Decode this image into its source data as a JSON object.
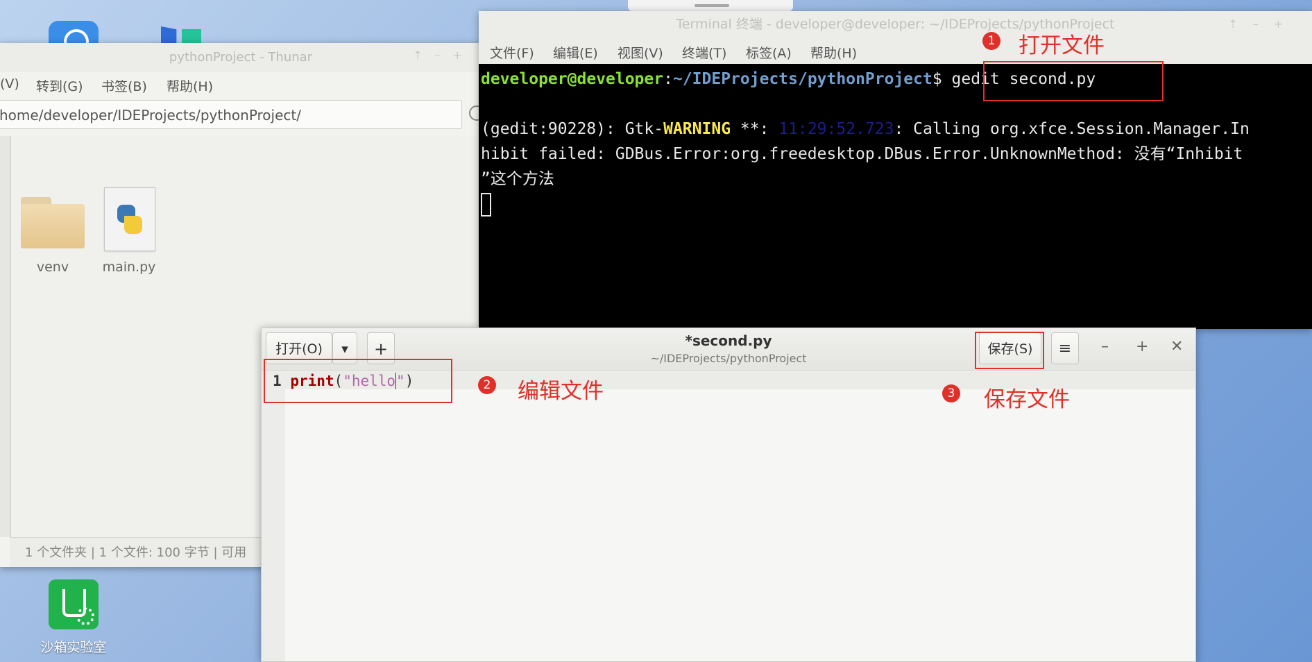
{
  "desktop": {
    "sandbox_label": "沙箱实验室"
  },
  "thunar": {
    "title": "pythonProject - Thunar",
    "menu": [
      "(V)",
      "转到(G)",
      "书签(B)",
      "帮助(H)"
    ],
    "path": "home/developer/IDEProjects/pythonProject/",
    "files": [
      {
        "name": "venv",
        "icon": "folder-icon"
      },
      {
        "name": "main.py",
        "icon": "python-file-icon"
      }
    ],
    "status": "1 个文件夹 | 1 个文件: 100 字节 | 可用"
  },
  "terminal": {
    "title": "Terminal 终端 - developer@developer: ~/IDEProjects/pythonProject",
    "menu": [
      "文件(F)",
      "编辑(E)",
      "视图(V)",
      "终端(T)",
      "标签(A)",
      "帮助(H)"
    ],
    "prompt_user": "developer@developer",
    "prompt_path": "~/IDEProjects/pythonProject",
    "command": "gedit second.py",
    "out_prefix": "(gedit:90228): Gtk-",
    "out_warning": "WARNING",
    "out_stars": " **: ",
    "out_time": "11:29:52.723",
    "out_rest1": ": Calling org.xfce.Session.Manager.In",
    "out_line2": "hibit failed: GDBus.Error:org.freedesktop.DBus.Error.UnknownMethod: 没有“Inhibit",
    "out_line3": "”这个方法"
  },
  "gedit": {
    "open_label": "打开(O)",
    "title": "*second.py",
    "subtitle": "~/IDEProjects/pythonProject",
    "save_label": "保存(S)",
    "line_number": "1",
    "code_kw": "print",
    "code_open": "(",
    "code_str": "\"hello",
    "code_str_end": "\"",
    "code_close": ")"
  },
  "annotations": [
    {
      "num": "1",
      "text": "打开文件"
    },
    {
      "num": "2",
      "text": "编辑文件"
    },
    {
      "num": "3",
      "text": "保存文件"
    }
  ],
  "colors": {
    "annotation_red": "#e0302a",
    "prompt_green": "#8ae234",
    "prompt_blue": "#729fcf",
    "warning_yellow": "#fce94f"
  }
}
